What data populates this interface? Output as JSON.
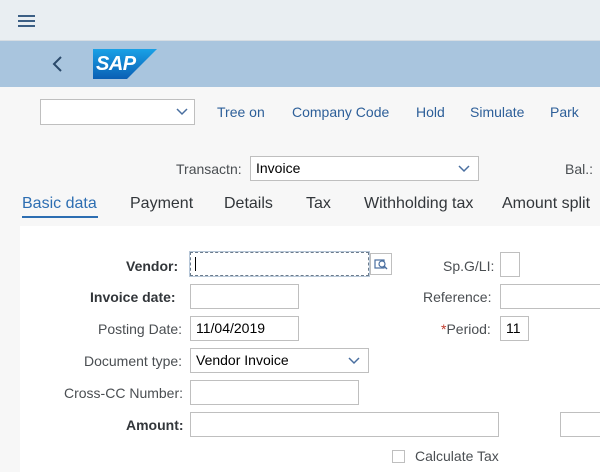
{
  "menu": {
    "icon": "hamburger-menu-icon"
  },
  "shell": {
    "back_icon": "chevron-left-icon",
    "logo_text": "SAP",
    "logo_color": "#0a6ed1"
  },
  "toolbar": {
    "layout_select_value": "",
    "buttons": [
      "Tree on",
      "Company Code",
      "Hold",
      "Simulate",
      "Park"
    ]
  },
  "header": {
    "transaction_label": "Transactn:",
    "transaction_value": "Invoice",
    "balance_label": "Bal.:"
  },
  "tabs": [
    "Basic data",
    "Payment",
    "Details",
    "Tax",
    "Withholding tax",
    "Amount split"
  ],
  "active_tab": "Basic data",
  "form": {
    "vendor_label": "Vendor:",
    "vendor_value": "",
    "invoice_date_label": "Invoice date:",
    "invoice_date_value": "",
    "posting_date_label": "Posting Date:",
    "posting_date_value": "11/04/2019",
    "document_type_label": "Document type:",
    "document_type_value": "Vendor Invoice",
    "cross_cc_label": "Cross-CC Number:",
    "cross_cc_value": "",
    "amount_label": "Amount:",
    "amount_value": "",
    "spgl_label": "Sp.G/LI:",
    "spgl_value": "",
    "reference_label": "Reference:",
    "reference_value": "",
    "period_required_mark": "*",
    "period_label": "Period:",
    "period_value": "11",
    "calculate_tax_label": "Calculate Tax",
    "calculate_tax_checked": false
  },
  "colors": {
    "link": "#2d5f99",
    "active_tab": "#2d6eb2",
    "shell": "#a9c5de"
  }
}
